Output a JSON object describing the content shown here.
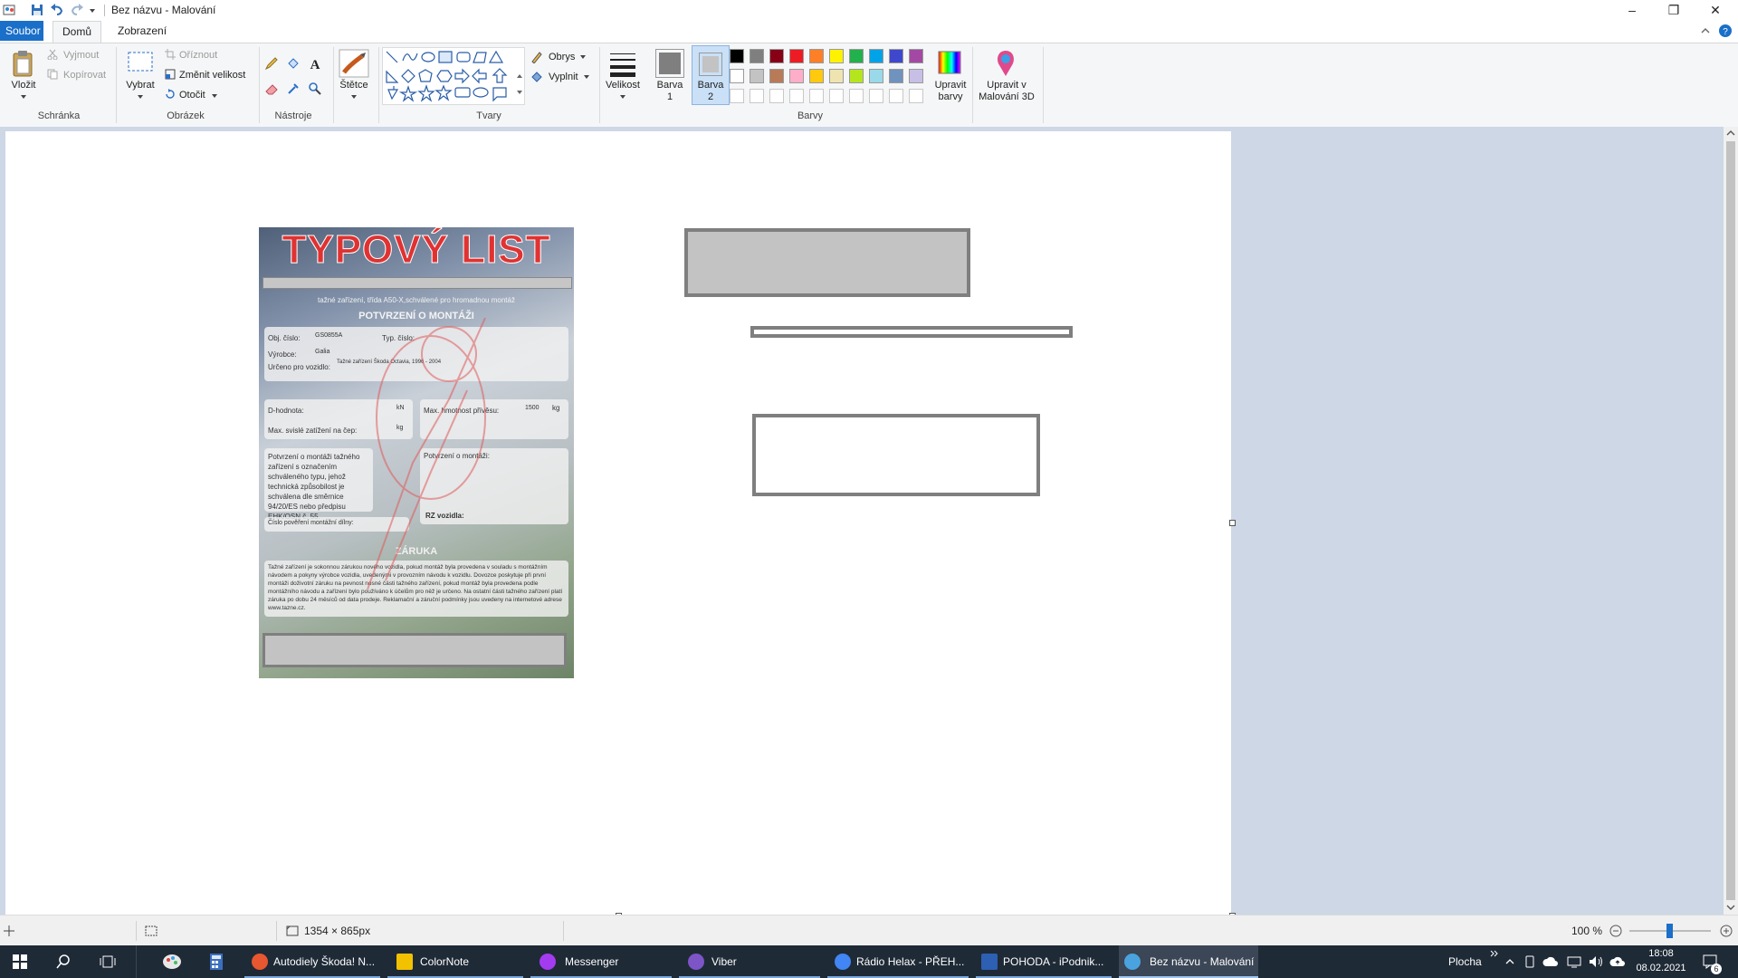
{
  "window": {
    "title": "Bez názvu - Malování",
    "controls": {
      "minimize": "–",
      "maximize": "❐",
      "close": "✕"
    }
  },
  "ribbon_tabs": [
    "Soubor",
    "Domů",
    "Zobrazení"
  ],
  "ribbon": {
    "clipboard": {
      "label": "Schránka",
      "paste": "Vložit",
      "cut": "Vyjmout",
      "copy": "Kopírovat"
    },
    "image": {
      "label": "Obrázek",
      "select": "Vybrat",
      "crop": "Oříznout",
      "resize": "Změnit velikost",
      "rotate": "Otočit"
    },
    "tools": {
      "label": "Nástroje"
    },
    "brushes": "Štětce",
    "shapes": {
      "label": "Tvary",
      "outline": "Obrys",
      "fill": "Vyplnit"
    },
    "size": "Velikost",
    "colors": {
      "label": "Barvy",
      "color1": "Barva",
      "color1_num": "1",
      "color2": "Barva",
      "color2_num": "2",
      "edit_colors_1": "Upravit",
      "edit_colors_2": "barvy",
      "paint3d_1": "Upravit v",
      "paint3d_2": "Malování 3D",
      "color1_hex": "#7f7f7f",
      "color2_hex": "#c3c3c3",
      "palette_row1": [
        "#000000",
        "#7f7f7f",
        "#880015",
        "#ed1c24",
        "#ff7f27",
        "#fff200",
        "#22b14c",
        "#00a2e8",
        "#3f48cc",
        "#a349a4"
      ],
      "palette_row2": [
        "#ffffff",
        "#c3c3c3",
        "#b97a57",
        "#ffaec9",
        "#ffc90e",
        "#efe4b0",
        "#b5e61d",
        "#99d9ea",
        "#7092be",
        "#c8bfe7"
      ]
    }
  },
  "document": {
    "title": "TYPOVÝ LIST",
    "subtitle": "tažné zařízení, třída A50-X,schválené pro hromadnou montáž",
    "section1": "POTVRZENÍ O MONTÁŽI",
    "obj_label": "Obj. číslo:",
    "obj_value": "GS0855A",
    "typ_label": "Typ. číslo:",
    "vyrobce_label": "Výrobce:",
    "vyrobce_value": "Galia",
    "urceno_label": "Určeno pro vozidlo:",
    "urceno_value": "Tažné zařízení Škoda Octavia, 1996 - 2004",
    "d_label": "D-hodnota:",
    "d_unit": "kN",
    "svisle_label": "Max. svislé zatížení na čep:",
    "svisle_unit": "kg",
    "hmotnost_label": "Max. hmotnost přívěsu:",
    "hmotnost_value": "1500",
    "hmotnost_unit": "kg",
    "confirm_text": "Potvrzení o montáži tažného zařízení s označením schváleného typu, jehož technická způsobilost je schválena dle směrnice 94/20/ES nebo předpisu EHK/OSN č. 55.",
    "confirm_right": "Potvrzení o montáži:",
    "rz_label": "RZ vozidla:",
    "cislo_label": "Číslo pověření montážní dílny:",
    "zaruka": "ZÁRUKA",
    "zaruka_text": "Tažné zařízení je sokonnou zárukou nového vozidla, pokud montáž byla provedena v souladu s montážním návodem a pokyny výrobce vozidla, uvedenými v provozním návodu k vozidlu. Dovozce poskytuje při první montáži doživotní záruku na pevnost nosné části tažného zařízení, pokud montáž byla provedena podle montážního návodu a zařízení bylo používáno k účelům pro něž je určeno. Na ostatní části tažného zařízení platí záruka po dobu 24 měsíců od data prodeje. Reklamační a záruční podmínky jsou uvedeny na internetové adrese www.tazne.cz."
  },
  "statusbar": {
    "dimensions": "1354 × 865px",
    "zoom": "100 %"
  },
  "taskbar": {
    "apps": [
      {
        "label": "Autodiely Škoda! N...",
        "color": "#e8572f"
      },
      {
        "label": "ColorNote",
        "color": "#f2c200"
      },
      {
        "label": "Messenger",
        "color": "#a33cf0"
      },
      {
        "label": "Viber",
        "color": "#7d55c7"
      },
      {
        "label": "Rádio Helax - PŘEH...",
        "color": "#4285f4"
      },
      {
        "label": "POHODA - iPodnik...",
        "color": "#2d5fb3"
      },
      {
        "label": "Bez názvu - Malování",
        "color": "#4aa3df"
      }
    ],
    "desktop": "Plocha",
    "time": "18:08",
    "date": "08.02.2021",
    "notifications": "6"
  }
}
